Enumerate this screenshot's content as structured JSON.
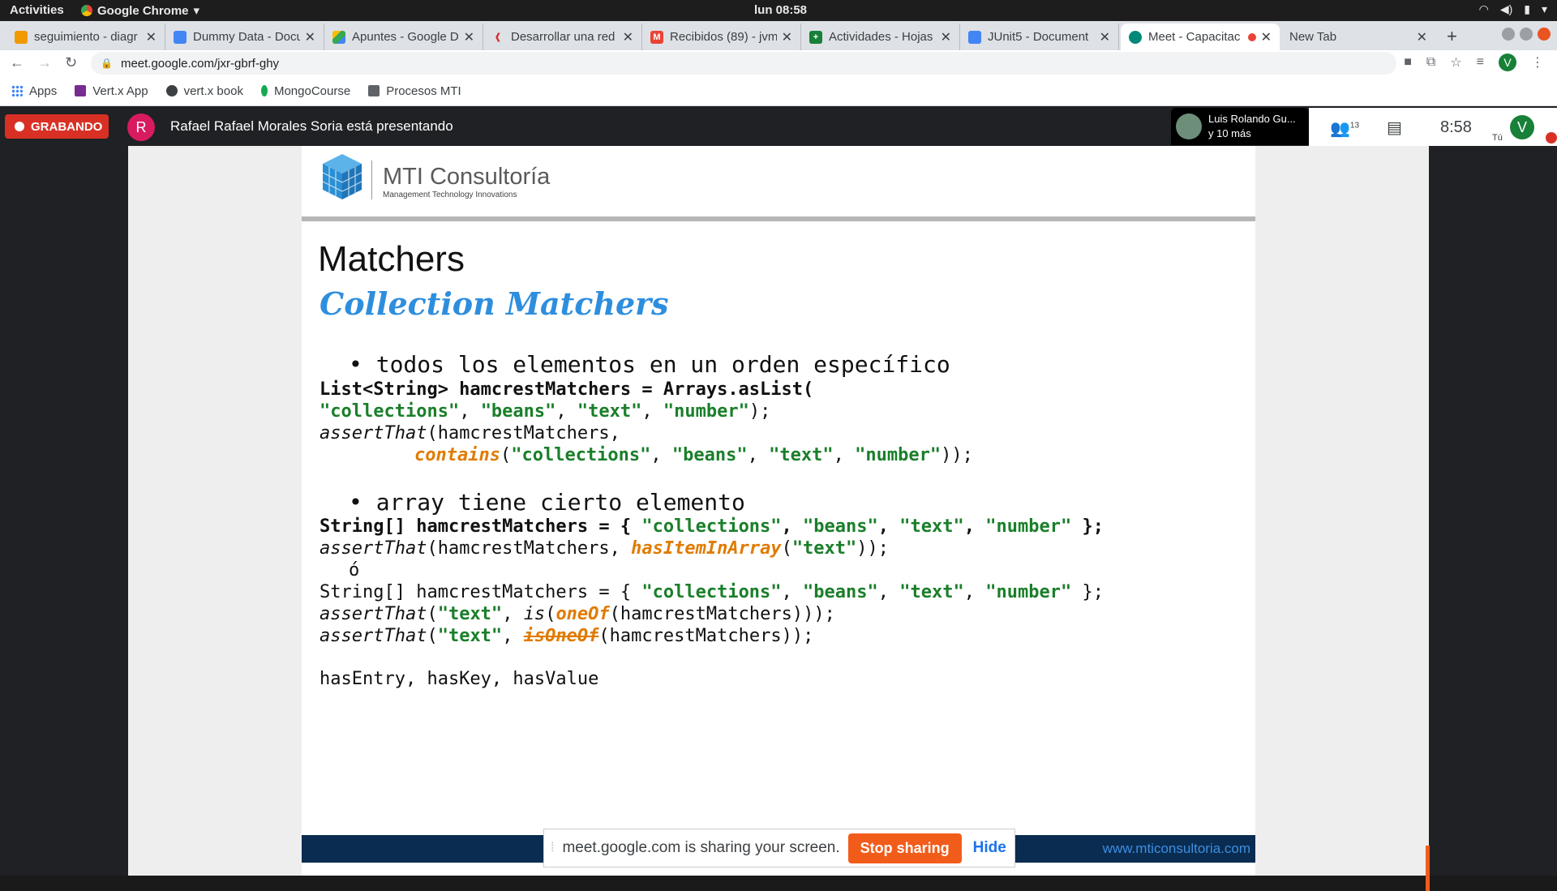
{
  "os": {
    "activities": "Activities",
    "app_name": "Google Chrome",
    "clock": "lun 08:58"
  },
  "tabs": [
    {
      "title": "seguimiento - diagr",
      "color": "#f29900"
    },
    {
      "title": "Dummy Data - Docu",
      "color": "#4285f4"
    },
    {
      "title": "Apuntes - Google D",
      "color": "#34a853"
    },
    {
      "title": "Desarrollar una red",
      "color": "#d32f2f"
    },
    {
      "title": "Recibidos (89) - jvm",
      "color": "#ea4335"
    },
    {
      "title": "Actividades - Hojas",
      "color": "#188038"
    },
    {
      "title": "JUnit5 - Document",
      "color": "#4285f4"
    },
    {
      "title": "Meet - Capacitac",
      "color": "#00897b"
    },
    {
      "title": "New Tab",
      "color": ""
    }
  ],
  "address": {
    "url": "meet.google.com/jxr-gbrf-ghy",
    "profile_initial": "V"
  },
  "bookmarks": [
    {
      "label": "Apps",
      "icon": "apps-grid-icon"
    },
    {
      "label": "Vert.x App",
      "icon": "vertx-icon"
    },
    {
      "label": "vert.x book",
      "icon": "globe-icon"
    },
    {
      "label": "MongoCourse",
      "icon": "leaf-icon"
    },
    {
      "label": "Procesos MTI",
      "icon": "folder-icon"
    }
  ],
  "meet": {
    "recording_label": "GRABANDO",
    "presenter_initial": "R",
    "presenter_text": "Rafael Rafael Morales Soria está presentando",
    "participant_name": "Luis Rolando Gu...",
    "participant_more": "y 10 más",
    "people_count": "13",
    "time": "8:58",
    "you_initial": "V",
    "you_label": "Tú"
  },
  "slide": {
    "logo_name": "MTI Consultoría",
    "logo_tagline": "Management Technology Innovations",
    "title": "Matchers",
    "subtitle": "Collection Matchers",
    "bullet1": "• todos los elementos en un orden específico",
    "code1_line1": "List<String> hamcrestMatchers = Arrays.asList(",
    "code1_line2_strs": [
      "\"collections\"",
      "\"beans\"",
      "\"text\"",
      "\"number\""
    ],
    "code1_line3": "assertThat(hamcrestMatchers,",
    "code1_line4_fn": "contains",
    "bullet2": "• array tiene cierto elemento",
    "code2_line1_prefix": "String[] hamcrestMatchers = {",
    "code2_fn": "hasItemInArray",
    "code2_or": "ó",
    "code2_oneof": "oneOf",
    "code2_isoneof": "isOneOf",
    "code_text_str": "\"text\"",
    "map_matchers": "hasEntry, hasKey, hasValue",
    "footer_url": "www.mticonsultoria.com"
  },
  "share_banner": {
    "message": "meet.google.com is sharing your screen.",
    "stop_label": "Stop sharing",
    "hide_label": "Hide"
  }
}
